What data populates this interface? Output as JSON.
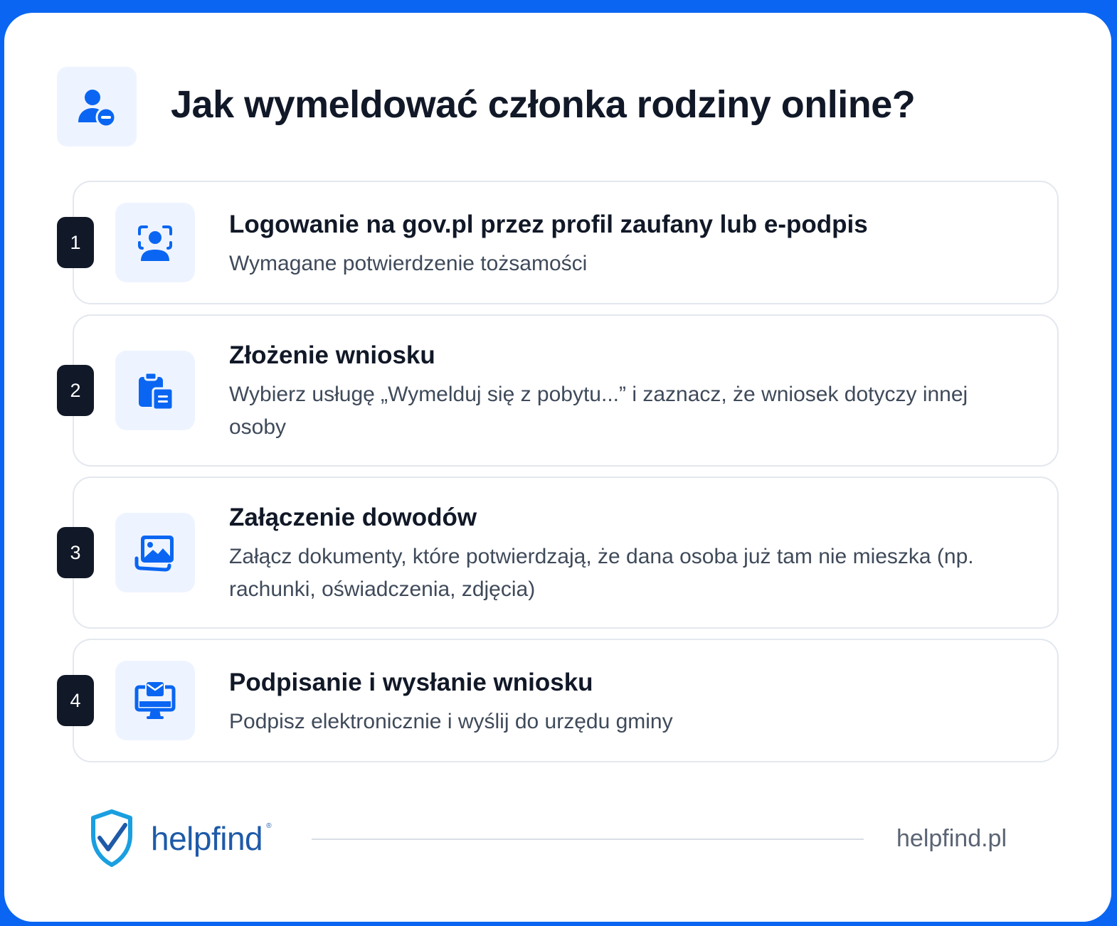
{
  "title": "Jak wymeldować członka rodziny online?",
  "header_icon": "user-minus-icon",
  "accent_color": "#0a66f2",
  "steps": [
    {
      "number": "1",
      "icon": "face-scan-user-icon",
      "title": "Logowanie na gov.pl przez profil zaufany lub e-podpis",
      "description": "Wymagane potwierdzenie tożsamości"
    },
    {
      "number": "2",
      "icon": "clipboard-document-icon",
      "title": "Złożenie wniosku",
      "description": "Wybierz usługę „Wymelduj się z pobytu...” i zaznacz, że wniosek dotyczy innej osoby"
    },
    {
      "number": "3",
      "icon": "images-icon",
      "title": "Załączenie dowodów",
      "description": "Załącz dokumenty, które potwierdzają, że dana osoba już tam nie mieszka (np. rachunki, oświadczenia, zdjęcia)"
    },
    {
      "number": "4",
      "icon": "monitor-mail-icon",
      "title": "Podpisanie i wysłanie wniosku",
      "description": "Podpisz elektronicznie i wyślij do urzędu gminy"
    }
  ],
  "footer": {
    "logo_text": "helpfind",
    "logo_mark": "®",
    "url": "helpfind.pl"
  }
}
